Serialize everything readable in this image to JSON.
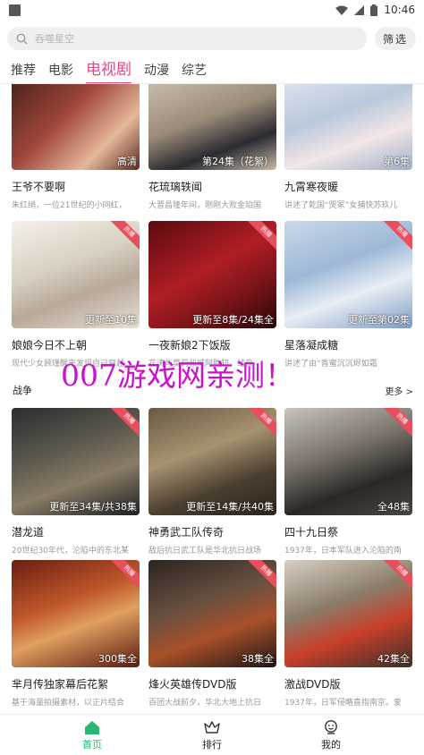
{
  "status_bar": {
    "time": "10:46",
    "icons": [
      "wifi-icon",
      "signal-icon",
      "battery-icon"
    ]
  },
  "search": {
    "placeholder": "吞噬星空",
    "filter_label": "筛选"
  },
  "tabs": [
    {
      "label": "推荐",
      "active": false
    },
    {
      "label": "电影",
      "active": false
    },
    {
      "label": "电视剧",
      "active": true
    },
    {
      "label": "动漫",
      "active": false
    },
    {
      "label": "综艺",
      "active": false
    }
  ],
  "rows": [
    {
      "items": [
        {
          "title": "王爷不要啊",
          "desc": "朱红绡，一位21世纪的小网红，",
          "note": "高清",
          "hot": false
        },
        {
          "title": "花琉璃轶闻",
          "desc": "大晋昌隆年间，刚刚大败金珀国",
          "note": "第24集（花絮）",
          "hot": false
        },
        {
          "title": "九霄寒夜暖",
          "desc": "讲述了乾国“煚冢”女捕快苏玖儿",
          "note": "第6集",
          "hot": false
        }
      ]
    },
    {
      "items": [
        {
          "title": "娘娘今日不上朝",
          "desc": "现代少女顾瑾醒来发现自己穿越",
          "note": "更新至10集",
          "hot": true,
          "ribbon": "热播"
        },
        {
          "title": "一夜新娘2下饭版",
          "desc": "花涛与莫莉叔城阿胜知，结良",
          "note": "更新至8集/24集全",
          "hot": true,
          "ribbon": "热播"
        },
        {
          "title": "星落凝成糖",
          "desc": "讲述了由“香蜜沉沉烬如霜",
          "note": "更新至第02集",
          "hot": true,
          "ribbon": "热播"
        }
      ]
    }
  ],
  "sections": [
    {
      "name": "战争",
      "more": "更多 >",
      "rows": [
        {
          "items": [
            {
              "title": "潜龙道",
              "desc": "20世纪30年代，沦陷中的东北某",
              "note": "更新至34集/共38集",
              "hot": true,
              "ribbon": "热播"
            },
            {
              "title": "神勇武工队传奇",
              "desc": "敌后抗日武工队是华北抗日战场",
              "note": "更新至14集/共40集",
              "hot": true,
              "ribbon": "热播"
            },
            {
              "title": "四十九日祭",
              "desc": "1937年，日本军队进入沦陷的南",
              "note": "全48集",
              "hot": true,
              "ribbon": "热播"
            }
          ]
        },
        {
          "items": [
            {
              "title": "芈月传独家幕后花絮",
              "desc": "基于海量拍摄素材，以正片结合",
              "note": "300集全",
              "hot": true,
              "ribbon": "热播"
            },
            {
              "title": "烽火英雄传DVD版",
              "desc": "百团大战前夕，华北大地上抗日",
              "note": "38集全",
              "hot": true,
              "ribbon": "热播"
            },
            {
              "title": "激战DVD版",
              "desc": "1937年，日军侵略直指南京。爱",
              "note": "42集全",
              "hot": true,
              "ribbon": "热播"
            }
          ]
        }
      ]
    }
  ],
  "watermark": "007游戏网亲测！",
  "bottom_nav": [
    {
      "label": "首页",
      "icon": "home-icon",
      "active": true
    },
    {
      "label": "排行",
      "icon": "ranking-icon",
      "active": false
    },
    {
      "label": "我的",
      "icon": "profile-icon",
      "active": false
    }
  ],
  "colors": {
    "accent": "#e8438b",
    "nav_active": "#2bb673",
    "ribbon": "#e84f5d",
    "watermark": "#cc11cc"
  }
}
